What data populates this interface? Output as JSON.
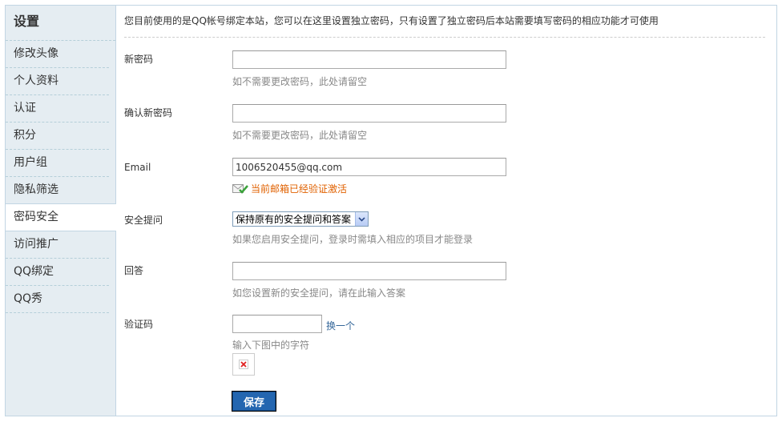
{
  "sidebar": {
    "title": "设置",
    "items": [
      {
        "label": "修改头像"
      },
      {
        "label": "个人资料"
      },
      {
        "label": "认证"
      },
      {
        "label": "积分"
      },
      {
        "label": "用户组"
      },
      {
        "label": "隐私筛选"
      },
      {
        "label": "密码安全",
        "active": true
      },
      {
        "label": "访问推广"
      },
      {
        "label": "QQ绑定"
      },
      {
        "label": "QQ秀"
      }
    ]
  },
  "notice": "您目前使用的是QQ帐号绑定本站，您可以在这里设置独立密码，只有设置了独立密码后本站需要填写密码的相应功能才可使用",
  "form": {
    "new_password": {
      "label": "新密码",
      "value": "",
      "hint": "如不需要更改密码，此处请留空"
    },
    "confirm_password": {
      "label": "确认新密码",
      "value": "",
      "hint": "如不需要更改密码，此处请留空"
    },
    "email": {
      "label": "Email",
      "value": "1006520455@qq.com",
      "status": "当前邮箱已经验证激活",
      "status_color": "#e06100"
    },
    "security_question": {
      "label": "安全提问",
      "selected": "保持原有的安全提问和答案",
      "hint": "如果您启用安全提问，登录时需填入相应的项目才能登录"
    },
    "answer": {
      "label": "回答",
      "value": "",
      "hint": "如您设置新的安全提问，请在此输入答案"
    },
    "captcha": {
      "label": "验证码",
      "value": "",
      "refresh_label": "换一个",
      "hint": "输入下图中的字符"
    },
    "save_label": "保存"
  },
  "colors": {
    "sidebar_bg": "#e5edf2",
    "accent_button": "#2466b0",
    "link": "#336699"
  }
}
